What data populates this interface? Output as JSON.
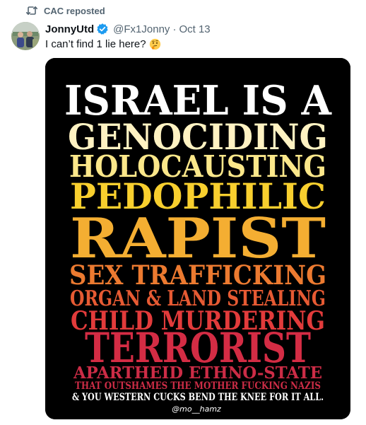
{
  "repost": {
    "label": "CAC reposted",
    "icon": "repost-icon"
  },
  "tweet": {
    "author_name": "JonnyUtd",
    "handle": "@Fx1Jonny",
    "separator": "·",
    "date": "Oct 13",
    "verified_icon": "verified-badge-icon",
    "verified_color": "#1d9bf0",
    "text": "I can’t find 1 lie here?",
    "emoji": "thinking-face-icon"
  },
  "poster": {
    "lines": [
      "ISRAEL IS A",
      "GENOCIDING",
      "HOLOCAUSTING",
      "PEDOPHILIC",
      "RAPIST",
      "SEX TRAFFICKING",
      "ORGAN & LAND STEALING",
      "CHILD MURDERING",
      "TERRORIST",
      "APARTHEID ETHNO-STATE",
      "THAT OUTSHAMES THE MOTHER FUCKING NAZIS",
      "& YOU WESTERN CUCKS BEND THE KNEE FOR IT ALL."
    ],
    "signature": "@mo__hamz",
    "colors": {
      "background": "#000000",
      "white": "#ffffff",
      "cream": "#fff2c2",
      "pale_yellow": "#fbe78a",
      "yellow": "#f8cf2e",
      "orange": "#f4ae32",
      "orange_red": "#ec7a30",
      "red_orange": "#e65a33",
      "red": "#e23b3b",
      "crimson": "#d42c44",
      "dark_red": "#cc2c46"
    }
  }
}
